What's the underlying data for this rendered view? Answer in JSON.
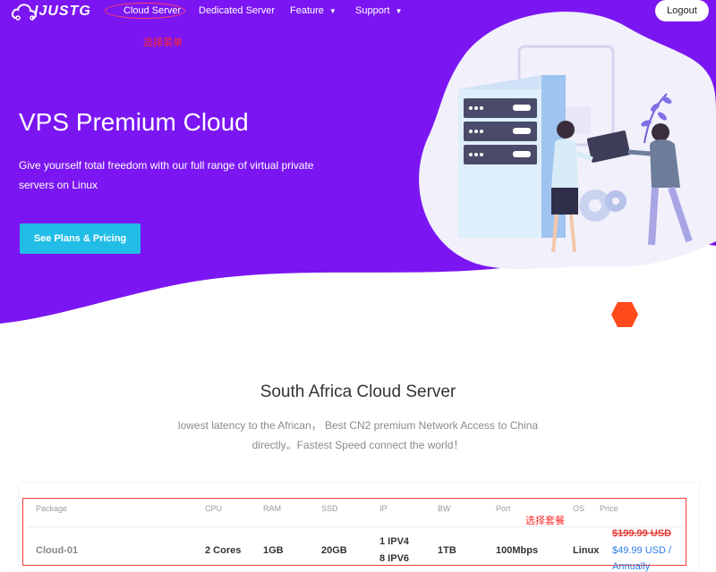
{
  "nav": {
    "logo_text": "IJUSTG",
    "items": [
      {
        "label": "Cloud Server"
      },
      {
        "label": "Dedicated Server"
      },
      {
        "label": "Feature",
        "chevron": "chevron-down-icon"
      },
      {
        "label": "Support",
        "chevron": "chevron-down-icon"
      }
    ],
    "logout_label": "Logout",
    "annotation": "选择菜单"
  },
  "hero": {
    "title": "VPS Premium Cloud",
    "subtitle": "Give yourself total freedom with our full range of virtual private servers on Linux",
    "cta_label": "See Plans & Pricing"
  },
  "section": {
    "title": "South Africa Cloud Server",
    "subtitle": "lowest latency to the African， Best CN2 premium Network Access to China directly。Fastest Speed connect the world！"
  },
  "table": {
    "annotation": "选择套餐",
    "headers": [
      "Package",
      "CPU",
      "RAM",
      "SSD",
      "IP",
      "BW",
      "Port",
      "OS",
      "Price"
    ],
    "rows": [
      {
        "package": "Cloud-01",
        "cpu": "2 Cores",
        "ram": "1GB",
        "ssd": "20GB",
        "ip_v4": "1 IPV4",
        "ip_v6": "8 IPV6",
        "bw": "1TB",
        "port": "100Mbps",
        "os": "Linux",
        "price_old": "$199.99 USD",
        "price_new": "$49.99 USD /",
        "price_period": "Annually"
      }
    ]
  },
  "colors": {
    "hero_purple": "#7b16f2",
    "cta": "#22bde6",
    "annotation_red": "#ff2a2a",
    "price_old": "#e53935",
    "price_new": "#2a7be4",
    "hexagon": "#ff4a1c"
  }
}
